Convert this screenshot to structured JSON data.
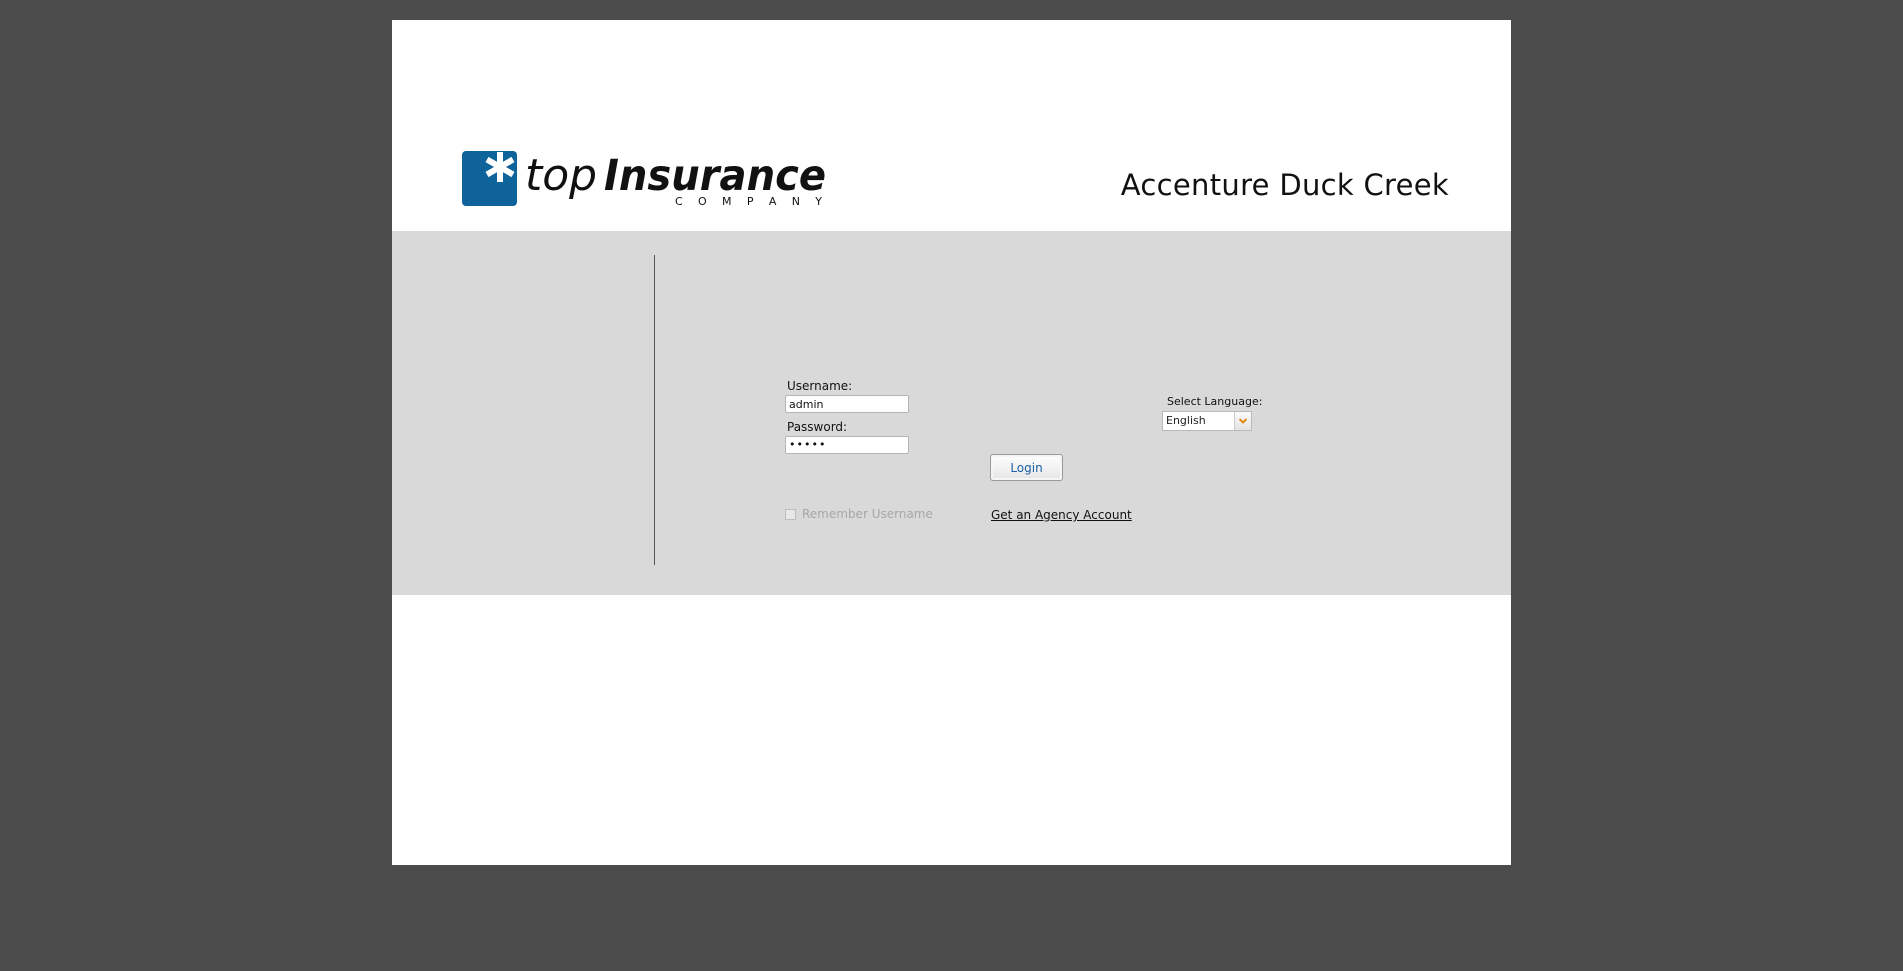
{
  "header": {
    "logo_top": "top",
    "logo_insurance": "Insurance",
    "logo_company": "C O M P A N Y",
    "app_title": "Accenture Duck Creek"
  },
  "login": {
    "username_label": "Username:",
    "username_value": "admin",
    "password_label": "Password:",
    "password_value": "•••••",
    "login_button": "Login",
    "remember_label": "Remember Username",
    "remember_checked": false,
    "agency_link": "Get an Agency Account"
  },
  "language": {
    "label": "Select Language:",
    "selected": "English"
  },
  "colors": {
    "background": "#4b4b4b",
    "band": "#d9d9d9",
    "logo_blue": "#0d639a",
    "link_blue": "#1a5fa8",
    "arrow_orange": "#e08a14"
  }
}
